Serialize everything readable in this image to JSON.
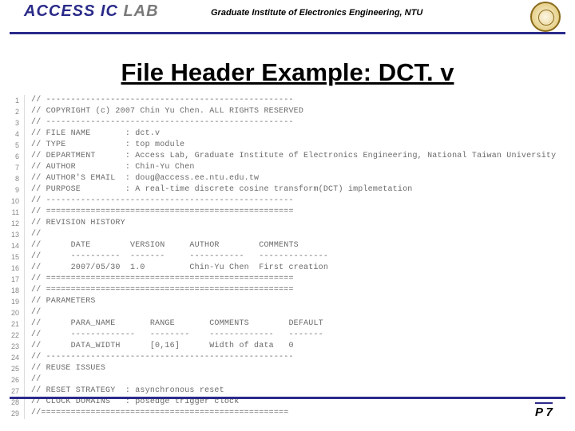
{
  "header": {
    "lab_access": "ACCESS IC ",
    "lab_lab": "LAB",
    "institute": "Graduate Institute of Electronics Engineering, NTU"
  },
  "title": "File Header Example: DCT. v",
  "footer": {
    "page": "P 7"
  },
  "code": [
    "// --------------------------------------------------",
    "// COPYRIGHT (c) 2007 Chin Yu Chen. ALL RIGHTS RESERVED",
    "// --------------------------------------------------",
    "// FILE NAME       : dct.v",
    "// TYPE            : top module",
    "// DEPARTMENT      : Access Lab, Graduate Institute of Electronics Engineering, National Taiwan University",
    "// AUTHOR          : Chin-Yu Chen",
    "// AUTHOR'S EMAIL  : doug@access.ee.ntu.edu.tw",
    "// PURPOSE         : A real-time discrete cosine transform(DCT) implemetation",
    "// --------------------------------------------------",
    "// ==================================================",
    "// REVISION HISTORY",
    "//",
    "//      DATE        VERSION     AUTHOR        COMMENTS",
    "//      ----------  -------     -----------   --------------",
    "//      2007/05/30  1.0         Chin-Yu Chen  First creation",
    "// ==================================================",
    "// ==================================================",
    "// PARAMETERS",
    "//",
    "//      PARA_NAME       RANGE       COMMENTS        DEFAULT",
    "//      -------------   --------    -------------   -------",
    "//      DATA_WIDTH      [0,16]      Width of data   0",
    "// --------------------------------------------------",
    "// REUSE ISSUES",
    "//",
    "// RESET STRATEGY  : asynchronous reset",
    "// CLOCK DOMAINS   : posedge trigger clock",
    "//=================================================="
  ]
}
